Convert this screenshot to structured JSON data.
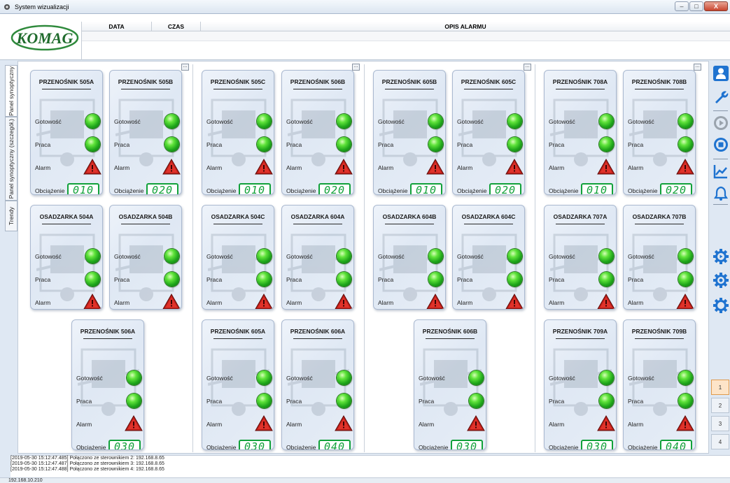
{
  "window": {
    "title": "System wizualizacji",
    "buttons": [
      "–",
      "□",
      "X"
    ]
  },
  "header": {
    "logo_text": "KOMAG",
    "alarm_columns": [
      "DATA",
      "CZAS",
      "OPIS ALARMU"
    ]
  },
  "tabs": [
    {
      "label": "Panel synoptyczny"
    },
    {
      "label": "Panel synoptyczny (szczegół.)"
    },
    {
      "label": "Trendy"
    }
  ],
  "labels": {
    "ready": "Gotowość",
    "work": "Praca",
    "alarm": "Alarm",
    "load": "Obciążenie",
    "dots": "..."
  },
  "cards": [
    {
      "title": "PRZENOŚNIK 505A",
      "load": "010"
    },
    {
      "title": "PRZENOŚNIK 505B",
      "load": "020"
    },
    {
      "title": "PRZENOŚNIK 505C",
      "load": "010"
    },
    {
      "title": "PRZENOŚNIK 506B",
      "load": "020"
    },
    {
      "title": "PRZENOŚNIK 605B",
      "load": "010"
    },
    {
      "title": "PRZENOŚNIK 605C",
      "load": "020"
    },
    {
      "title": "PRZENOŚNIK 708A",
      "load": "010"
    },
    {
      "title": "PRZENOŚNIK 708B",
      "load": "020"
    },
    {
      "title": "OSADZARKA 504A"
    },
    {
      "title": "OSADZARKA 504B"
    },
    {
      "title": "OSADZARKA 504C"
    },
    {
      "title": "OSADZARKA 604A"
    },
    {
      "title": "OSADZARKA 604B"
    },
    {
      "title": "OSADZARKA 604C"
    },
    {
      "title": "OSADZARKA 707A"
    },
    {
      "title": "OSADZARKA 707B"
    },
    {
      "title": "PRZENOŚNIK 506A",
      "load": "030"
    },
    {
      "title": "PRZENOŚNIK 605A",
      "load": "030"
    },
    {
      "title": "PRZENOŚNIK 606A",
      "load": "040"
    },
    {
      "title": "PRZENOŚNIK 606B",
      "load": "030"
    },
    {
      "title": "PRZENOŚNIK 709A",
      "load": "030"
    },
    {
      "title": "PRZENOŚNIK 709B",
      "load": "040"
    }
  ],
  "toolbar": {
    "icons": [
      "user-icon",
      "wrench-icon",
      "play-icon",
      "stop-icon",
      "trend-chart-icon",
      "bell-icon",
      "gear-play-icon",
      "gear-icon",
      "gear-outline-icon"
    ],
    "pages": [
      "1",
      "2",
      "3",
      "4"
    ],
    "active_page": "1"
  },
  "log": [
    "[2019-05-30 15:12:47.485] Połączono ze sterownikiem 2: 192.168.8.65",
    "[2019-05-30 15:12:47.487] Połączono ze sterownikiem 3: 192.168.8.65",
    "[2019-05-30 15:12:47.488] Połączono ze sterownikiem 4: 192.168.8.65"
  ],
  "status": {
    "ip": "192.168.10.210"
  },
  "colors": {
    "lamp_green": "#3ccf2a",
    "alarm_red": "#c0201a",
    "segment_green": "#11a13a",
    "active_page": "#fde4c8",
    "toolbar_blue": "#1f73d0"
  }
}
